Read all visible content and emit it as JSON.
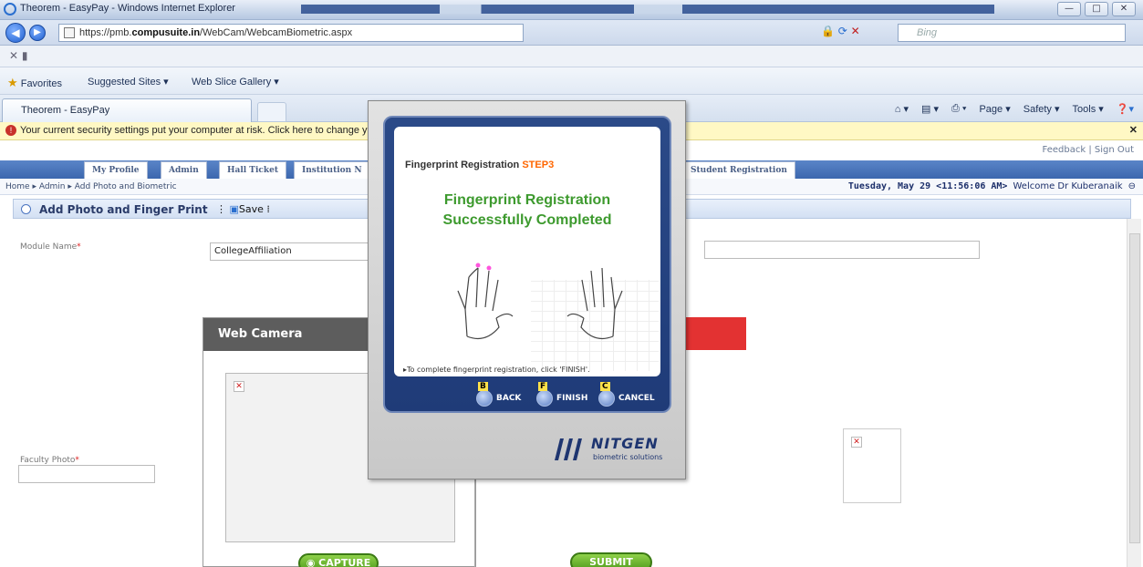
{
  "window": {
    "title": "Theorem - EasyPay - Windows Internet Explorer",
    "url_prefix": "https://pmb.",
    "url_domain": "compusuite.in",
    "url_path": "/WebCam/WebcamBiometric.aspx",
    "search_placeholder": "Bing"
  },
  "favorites": {
    "favorites_label": "Favorites",
    "suggested_sites": "Suggested Sites ▾",
    "web_slice": "Web Slice Gallery ▾"
  },
  "tab": {
    "label": "Theorem - EasyPay"
  },
  "toolbar": {
    "page": "Page ▾",
    "safety": "Safety ▾",
    "tools": "Tools ▾"
  },
  "infobar": {
    "text": "Your current security settings put your computer at risk. Click here to change y"
  },
  "site": {
    "feedback": "Feedback",
    "signout": "Sign Out",
    "menu": [
      "My Profile",
      "Admin",
      "Hall Ticket",
      "Institution N",
      "Student Registration"
    ],
    "breadcrumb": "Home ▸ Admin ▸ Add Photo and Biometric",
    "date": "Tuesday, May 29 <11:56:06 AM>",
    "welcome": "Welcome Dr Kuberanaik"
  },
  "section": {
    "title": "Add Photo and Finger Print",
    "save": "Save"
  },
  "form": {
    "module_label": "Module Name",
    "module_value": "CollegeAffiliation",
    "faculty_photo_label": "Faculty Photo",
    "webcam_title": "Web Camera",
    "capture": "CAPTURE",
    "submit": "SUBMIT"
  },
  "dialog": {
    "title": "Fingerprint Registration",
    "step": "STEP3",
    "line1": "Fingerprint Registration",
    "line2": "Successfully Completed",
    "instruction": "▸To complete fingerprint registration, click 'FINISH'.",
    "back": "BACK",
    "finish": "FINISH",
    "cancel": "CANCEL",
    "key_back": "B",
    "key_finish": "F",
    "key_cancel": "C",
    "brand": "NITGEN",
    "brand_sub": "biometric solutions"
  }
}
